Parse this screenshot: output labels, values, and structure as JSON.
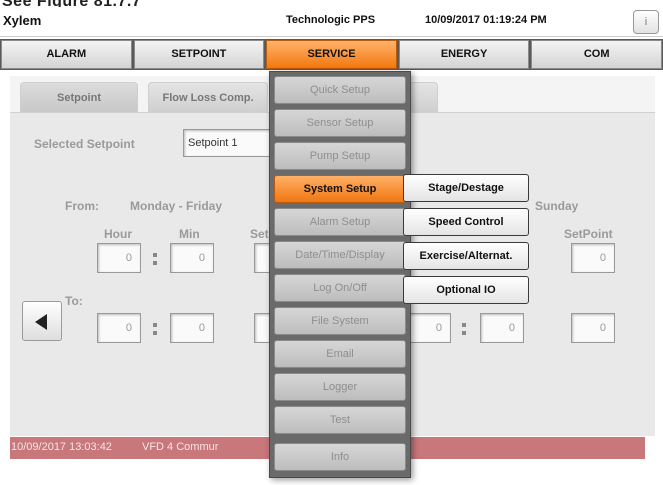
{
  "caption": "See Figure 81.7.7",
  "titlebar": {
    "brand": "Xylem",
    "device": "Technologic PPS",
    "datetime": "10/09/2017 01:19:24 PM",
    "info_label": "i"
  },
  "nav": {
    "tabs": [
      {
        "label": "ALARM"
      },
      {
        "label": "SETPOINT"
      },
      {
        "label": "SERVICE"
      },
      {
        "label": "ENERGY"
      },
      {
        "label": "COM"
      }
    ],
    "active": "SERVICE"
  },
  "subtabs": [
    {
      "label": "Setpoint"
    },
    {
      "label": "Flow Loss Comp."
    }
  ],
  "setpoint_panel": {
    "selected_label": "Selected Setpoint",
    "selected_value": "Setpoint 1",
    "from_label": "From:",
    "from_days": "Monday - Friday",
    "hour_label": "Hour",
    "min_label": "Min",
    "setpoint_partial": "Set",
    "sunday_label": "Sunday",
    "setpoint_col_label": "SetPoint",
    "to_label": "To:",
    "from_hour": "0",
    "from_min": "0",
    "to_hour": "0",
    "to_min": "0",
    "sunday_from_setpoint": "0",
    "sunday_to_hour": "0",
    "sunday_to_min": "0",
    "sunday_to_setpoint": "0"
  },
  "status": {
    "timestamp": "10/09/2017 13:03:42",
    "message": "VFD 4 Commur"
  },
  "service_menu": {
    "items": [
      "Quick Setup",
      "Sensor Setup",
      "Pump Setup",
      "System Setup",
      "Alarm Setup",
      "Date/Time/Display",
      "Log On/Off",
      "File System",
      "Email",
      "Logger",
      "Test",
      "Info"
    ],
    "active": "System Setup"
  },
  "system_setup_submenu": {
    "items": [
      "Stage/Destage",
      "Speed Control",
      "Exercise/Alternat.",
      "Optional IO"
    ]
  },
  "colors": {
    "accent_orange": "#f2780f",
    "nav_bg": "#5a5a5a",
    "status_bg": "#c8777b",
    "menu_bg": "#6a6a6a"
  },
  "icons": {
    "back": "left-triangle-icon"
  }
}
